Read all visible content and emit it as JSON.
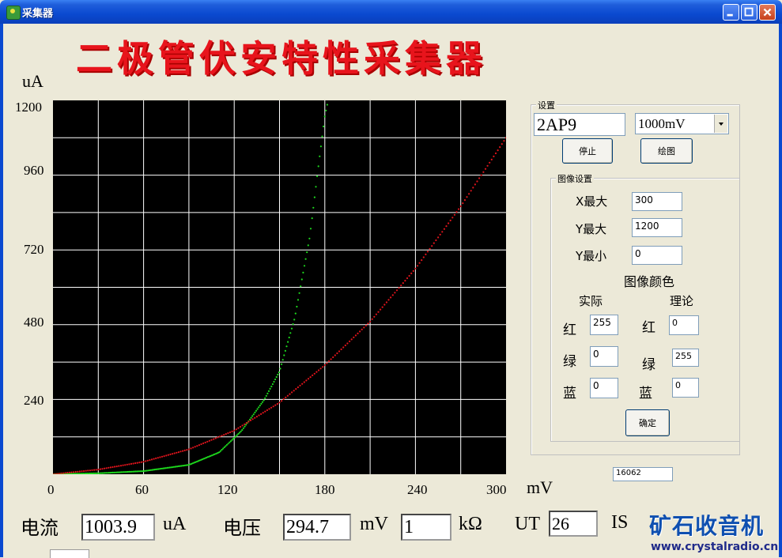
{
  "window": {
    "title": "采集器"
  },
  "heading": "二极管伏安特性采集器",
  "chart_data": {
    "type": "scatter",
    "xlim": [
      0,
      300
    ],
    "ylim": [
      0,
      1200
    ],
    "xlabel": "mV",
    "ylabel": "uA",
    "x_ticks": [
      "0",
      "60",
      "120",
      "180",
      "240",
      "300"
    ],
    "y_ticks": [
      "1200",
      "960",
      "720",
      "480",
      "240"
    ],
    "background": "#000000",
    "grid": true,
    "series": [
      {
        "color": "#1DD81D",
        "x": [
          0,
          30,
          60,
          90,
          110,
          125,
          140,
          150,
          160,
          170,
          175,
          180,
          185
        ],
        "y": [
          0,
          3,
          10,
          30,
          70,
          140,
          240,
          330,
          500,
          760,
          960,
          1150,
          1260
        ]
      },
      {
        "color": "#E0141C",
        "x": [
          0,
          30,
          60,
          90,
          120,
          150,
          180,
          210,
          240,
          270,
          300
        ],
        "y": [
          0,
          15,
          40,
          80,
          140,
          230,
          350,
          490,
          660,
          860,
          1080
        ]
      }
    ]
  },
  "settings": {
    "group_title": "设置",
    "model": "2AP9",
    "range_select": "1000mV",
    "stop_label": "停止",
    "plot_label": "绘图",
    "image_group_title": "图像设置",
    "x_max_label": "X最大",
    "x_max": "300",
    "y_max_label": "Y最大",
    "y_max": "1200",
    "y_min_label": "Y最小",
    "y_min": "0",
    "color_title": "图像颜色",
    "actual_label": "实际",
    "theory_label": "理论",
    "red_label": "红",
    "green_label": "绿",
    "blue_label": "蓝",
    "actual_r": "255",
    "actual_g": "0",
    "actual_b": "0",
    "theory_r": "0",
    "theory_g": "255",
    "theory_b": "0",
    "ok_label": "确定",
    "counter": "16062"
  },
  "bottom": {
    "current_label": "电流",
    "current_value": "1003.9",
    "current_unit": "uA",
    "voltage_label": "电压",
    "voltage_value": "294.7",
    "voltage_unit": "mV",
    "resistance_value": "1",
    "resistance_unit": "kΩ",
    "ut_label": "UT",
    "ut_value": "26",
    "is_label": "IS"
  },
  "watermark": {
    "text": "矿石收音机",
    "url": "www.crystalradio.cn"
  }
}
